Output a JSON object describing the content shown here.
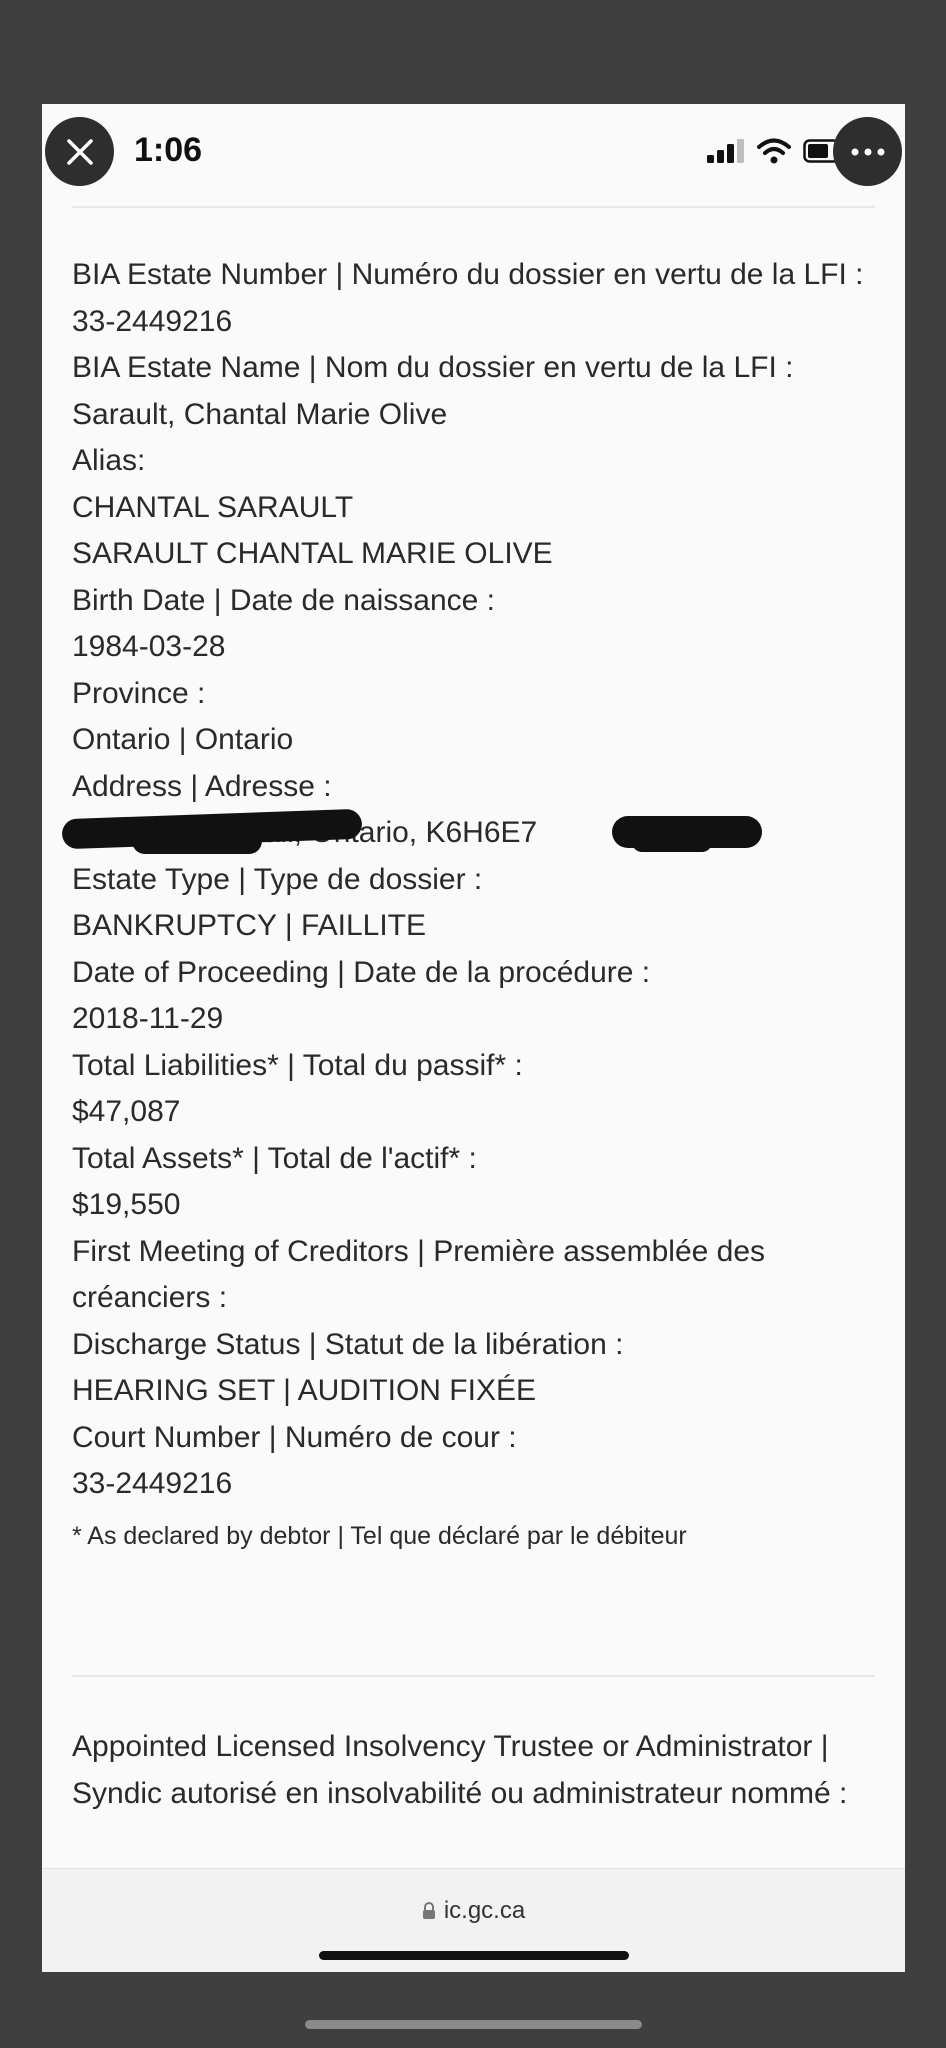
{
  "status_bar": {
    "time": "1:06"
  },
  "record": {
    "lines": [
      "BIA Estate Number | Numéro du dossier en vertu de la LFI :",
      "33-2449216",
      "BIA Estate Name | Nom du dossier en vertu de la LFI :",
      "Sarault, Chantal Marie Olive",
      "Alias:",
      "CHANTAL SARAULT",
      "SARAULT CHANTAL MARIE OLIVE",
      "Birth Date | Date de naissance :",
      "1984-03-28",
      "Province :",
      "Ontario | Ontario",
      "Address | Adresse :"
    ],
    "address_value": "84 Ch           , Cornwall, Ontario, K6H6E7",
    "lines_after": [
      "Estate Type | Type de dossier :",
      "BANKRUPTCY | FAILLITE",
      "Date of Proceeding | Date de la procédure :",
      "2018-11-29",
      "Total Liabilities* | Total du passif* :",
      "$47,087",
      "Total Assets* | Total de l'actif* :",
      "$19,550",
      "First Meeting of Creditors | Première assemblée des créanciers :",
      "Discharge Status | Statut de la libération :",
      "HEARING SET | AUDITION FIXÉE",
      "Court Number | Numéro de cour :",
      "33-2449216"
    ],
    "footnote": "* As declared by debtor | Tel que déclaré par le débiteur"
  },
  "trustee_heading": "Appointed Licensed Insolvency Trustee or Administrator | Syndic autorisé en insolvabilité ou administrateur nommé :",
  "browser": {
    "url": "ic.gc.ca"
  },
  "icons": {
    "close": "close-icon",
    "more": "more-icon",
    "signal": "cellular-signal-icon",
    "wifi": "wifi-icon",
    "battery": "battery-icon",
    "lock": "lock-icon"
  }
}
